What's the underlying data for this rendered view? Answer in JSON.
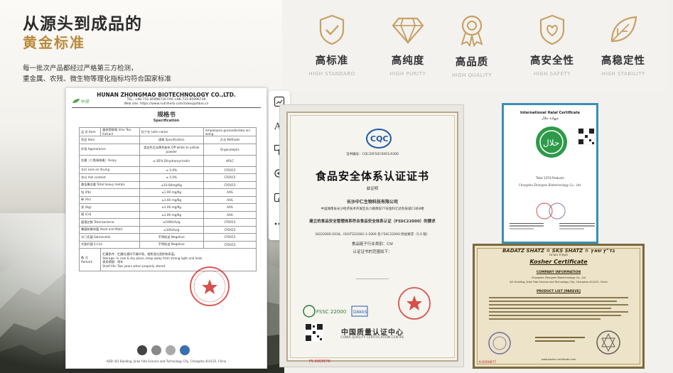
{
  "hero": {
    "title": "从源头到成品的",
    "subtitle": "黄金标准",
    "description_line1": "每一批次产品都经过严格第三方检测，",
    "description_line2": "重金属、农残、微生物等理化指标均符合国家标准"
  },
  "quality_items": [
    {
      "cn": "高标准",
      "en": "HIGH STANDARD",
      "icon": "shield-check-icon"
    },
    {
      "cn": "高纯度",
      "en": "HIGH PURITY",
      "icon": "diamond-icon"
    },
    {
      "cn": "高品质",
      "en": "HIGH QUALITY",
      "icon": "award-ribbon-icon"
    },
    {
      "cn": "高安全性",
      "en": "HIGH SAFETY",
      "icon": "shield-heart-icon"
    },
    {
      "cn": "高稳定性",
      "en": "HIGH STABILITY",
      "icon": "leaf-icon"
    }
  ],
  "spec_doc": {
    "company": "HUNAN ZHONGMAO BIOTECHNOLOGY CO.,LTD.",
    "phone": "TEL: +86-731-85996730          FAX:+86-731-85996739",
    "website": "Web site: https://www.nutriherb.com/sales@zhbio.cn",
    "title_cn": "规格书",
    "title_en": "Specification",
    "item_label": "品  名  Item",
    "item_value": "藤茶提取物 Vine Tea Extract",
    "latin_label": "拉丁名  Latin name",
    "latin_value": "Ampelopsis grossedentata w.t. wang",
    "header_item": "项目 Item",
    "header_spec": "规格 Specification",
    "header_method": "方法 Methods",
    "rows": [
      {
        "item": "外观  Appearance",
        "spec": "类白色至淡黄色粉末 Off white to yellow powder",
        "method": "Organoleptic"
      },
      {
        "item": "含量（二氢杨梅素）Assay",
        "spec": "≥ 85% Dihydromyricetin",
        "method": "HPLC"
      },
      {
        "item": "水分  Loss on drying",
        "spec": "≤ 5.0%",
        "method": "CP2015"
      },
      {
        "item": "灰分  Ash content",
        "spec": "≤ 5.0%",
        "method": "CP2015"
      },
      {
        "item": "重金属总量 Total heavy metals",
        "spec": "≤10.00mg/Kg",
        "method": "CP2015"
      },
      {
        "item": "铅 (Pb)",
        "spec": "≤1.00 mg/Kg",
        "method": "AAS"
      },
      {
        "item": "砷 (As)",
        "spec": "≤1.00 mg/Kg",
        "method": "AAS"
      },
      {
        "item": "汞 (Hg)",
        "spec": "≤1.00 mg/Kg",
        "method": "AAS"
      },
      {
        "item": "镉 (Cd)",
        "spec": "≤1.00 mg/Kg",
        "method": "AAS"
      },
      {
        "item": "菌落总数  Total bacteria",
        "spec": "≤1000cfu/g",
        "method": "CP2015"
      },
      {
        "item": "霉菌和酵母菌 Yeast and Mold",
        "spec": "≤100cfu/g",
        "method": "CP2015"
      },
      {
        "item": "沙门氏菌 Salmonella",
        "spec": "不得检出 Negative",
        "method": "CP2015"
      },
      {
        "item": "大肠杆菌 E.Coli",
        "spec": "不得检出 Negative",
        "method": "CP2015"
      }
    ],
    "remark_label": "备  注  Remark",
    "remark_cn": "贮藏条件：贮藏在通风干燥环境，避免强光直射和高温。",
    "remark_storage": "Storage: In cool & dry place, keep away from strong light and heat.",
    "remark_shelf_cn": "保质期限：两年",
    "remark_shelf": "Shelf life: Two years when properly stored.",
    "footer": "ADD: 8/1 Building, Jinke Yida Science and Technology City, Changsha 410125, China"
  },
  "food_cert": {
    "title": "食品安全体系认证证书",
    "number": "证书编号：CQC20FSSC0001/4300",
    "issued_to": "兹证明",
    "company": "长沙中仁生物科技有限公司",
    "address": "中国湖南省长沙经济技术开发区东六路南段77号金科亿达科技城C1栋8楼",
    "statement": "建立的食品安全管理体系符合食品安全体系认证（FSSC22000）的要求",
    "standards": "ISO22000:2018，ISO/TS22002-1:2009 及 FSSC22000 附加要求（5.0 版）",
    "category": "食品链子行业类别：CⅣ",
    "scope": "认证证书的范围如下：",
    "center": "中国质量认证中心",
    "center_en": "CHINA QUALITY CERTIFICATION CENTRE",
    "serial": "FS 0003576"
  },
  "halal_cert": {
    "title": "International Halal Certificate",
    "title_ar": "شهادة حلال",
    "products": "Total 1374 Products",
    "company": "Changsha Zhongren Biotechnology Co., Ltd."
  },
  "kosher_cert": {
    "header": "BADATZ SHATZ ✡ SKS SHATZ ✡ בד\"ץ שאץ",
    "hebrew": "תעודת כשרות",
    "title": "Kosher Certificate",
    "company_label": "COMPANY INFORMATION",
    "company": "Changsha Zhongren Biotechnology Co., Ltd",
    "address": "8/1 Building, Jinke Yida Science and Technology City, Changsha 410125, China",
    "products_label": "PRODUCT LIST [PAREVE]",
    "footer": "www.kosher-certificate.com",
    "serial": "K-0000877"
  },
  "toolbar": [
    {
      "icon": "image-edit-icon"
    },
    {
      "icon": "text-edit-icon"
    },
    {
      "icon": "translate-icon"
    },
    {
      "icon": "zoom-icon"
    },
    {
      "icon": "image-search-icon"
    },
    {
      "icon": "more-icon"
    }
  ],
  "colors": {
    "gold": "#b88a3c",
    "icon_gold": "#c9a063",
    "cqc_blue": "#1e5aa8",
    "stamp_red": "#d0312d"
  }
}
